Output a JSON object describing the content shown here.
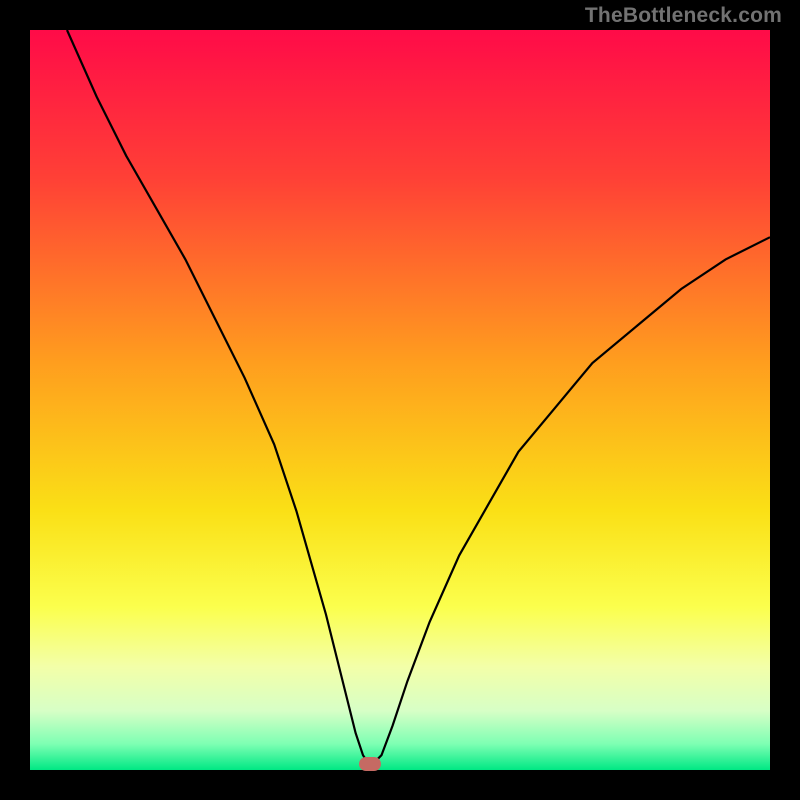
{
  "watermark": "TheBottleneck.com",
  "chart_data": {
    "type": "line",
    "title": "",
    "xlabel": "",
    "ylabel": "",
    "xlim": [
      0,
      100
    ],
    "ylim": [
      0,
      100
    ],
    "grid": false,
    "legend_position": "none",
    "background_gradient": {
      "stops": [
        {
          "pos": 0.0,
          "color": "#ff0b48"
        },
        {
          "pos": 0.2,
          "color": "#ff4036"
        },
        {
          "pos": 0.45,
          "color": "#ff9e1e"
        },
        {
          "pos": 0.65,
          "color": "#fae016"
        },
        {
          "pos": 0.78,
          "color": "#fbff4d"
        },
        {
          "pos": 0.86,
          "color": "#f3ffa8"
        },
        {
          "pos": 0.92,
          "color": "#d7ffc6"
        },
        {
          "pos": 0.965,
          "color": "#7dffb3"
        },
        {
          "pos": 1.0,
          "color": "#00e884"
        }
      ]
    },
    "series": [
      {
        "name": "bottleneck-curve",
        "color": "#000000",
        "x": [
          5,
          9,
          13,
          17,
          21,
          25,
          29,
          33,
          36,
          38,
          40,
          41.5,
          43,
          44,
          45,
          45.8,
          46.3,
          47.5,
          49,
          51,
          54,
          58,
          62,
          66,
          71,
          76,
          82,
          88,
          94,
          100
        ],
        "y": [
          100,
          91,
          83,
          76,
          69,
          61,
          53,
          44,
          35,
          28,
          21,
          15,
          9,
          5,
          2,
          0.8,
          0.8,
          2,
          6,
          12,
          20,
          29,
          36,
          43,
          49,
          55,
          60,
          65,
          69,
          72
        ]
      }
    ],
    "marker": {
      "name": "optimal-point",
      "x": 46,
      "y": 0.8,
      "color": "#c56a63"
    }
  }
}
